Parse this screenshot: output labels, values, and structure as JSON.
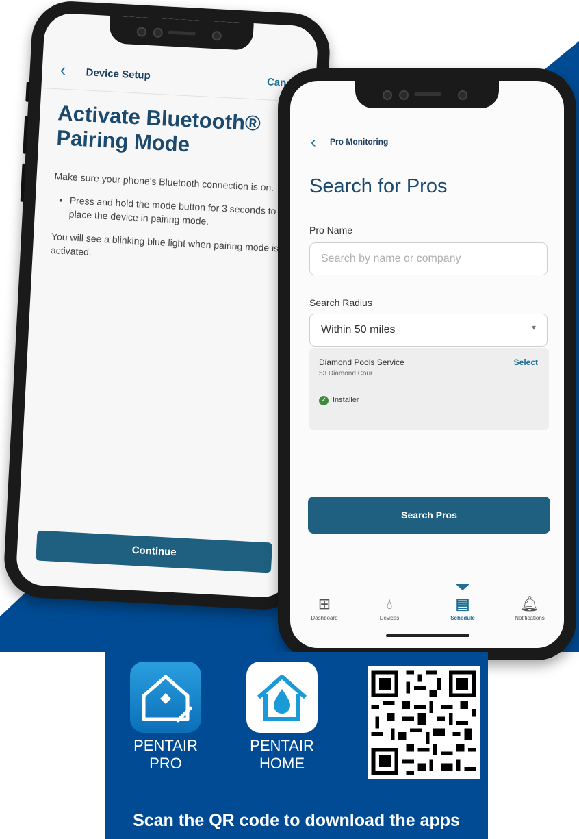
{
  "colors": {
    "brand_blue": "#004b93",
    "button_teal": "#1f6080",
    "link_blue": "#1f6f97",
    "heading_navy": "#1b4a6e"
  },
  "device_setup": {
    "nav_title": "Device Setup",
    "cancel_label": "Cancel",
    "heading": "Activate Bluetooth® Pairing Mode",
    "intro": "Make sure your phone's Bluetooth connection is on.",
    "bullet": "Press and hold the mode button for 3 seconds to place the device in pairing mode.",
    "note": "You will see a blinking blue light when pairing mode is activated.",
    "continue_label": "Continue"
  },
  "pro_search": {
    "nav_title": "Pro Monitoring",
    "heading": "Search for Pros",
    "pro_name_label": "Pro Name",
    "pro_name_placeholder": "Search by name or company",
    "radius_label": "Search Radius",
    "radius_value": "Within 50 miles",
    "result": {
      "name": "Diamond Pools Service",
      "address": "53 Diamond Cour",
      "select_label": "Select",
      "badge": "Installer"
    },
    "search_button_label": "Search Pros",
    "tabs": [
      {
        "label": "Dashboard",
        "icon": "grid-icon"
      },
      {
        "label": "Devices",
        "icon": "water-drop-icon"
      },
      {
        "label": "Schedule",
        "icon": "calendar-icon",
        "active": true
      },
      {
        "label": "Notifications",
        "icon": "bell-icon"
      }
    ]
  },
  "promo": {
    "app1_label_line1": "PENTAIR",
    "app1_label_line2": "PRO",
    "app2_label_line1": "PENTAIR",
    "app2_label_line2": "HOME",
    "cta": "Scan the QR code to download the apps"
  }
}
